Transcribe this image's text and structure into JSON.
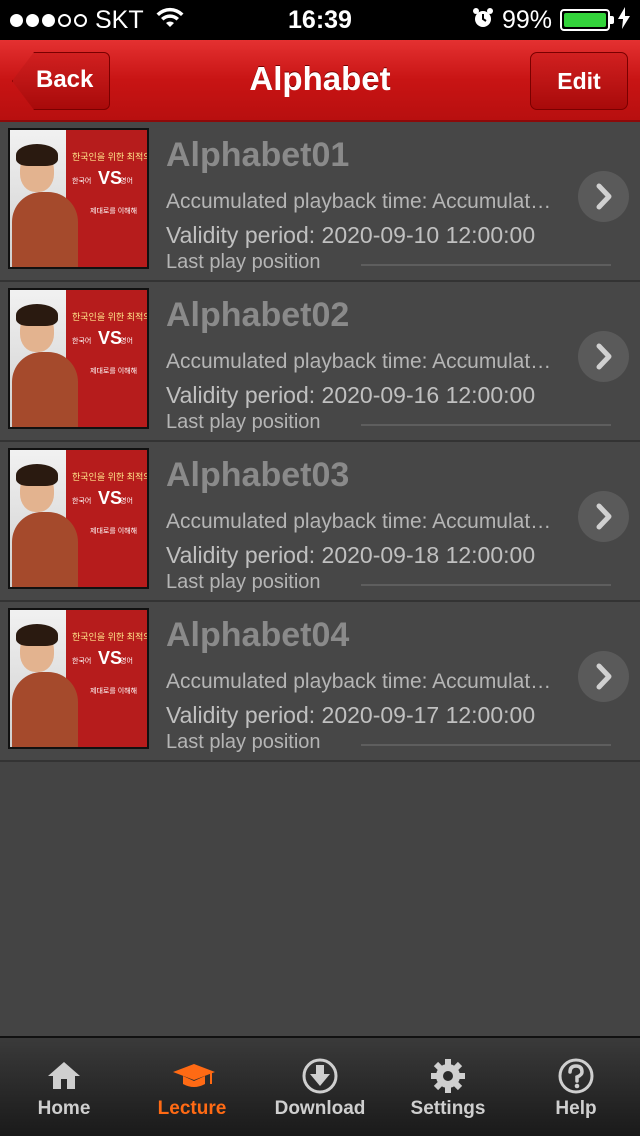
{
  "status_bar": {
    "carrier": "SKT",
    "time": "16:39",
    "battery_percent": "99%",
    "battery_level": 0.99,
    "signal_bars_filled": 3,
    "signal_bars_total": 5
  },
  "nav": {
    "title": "Alphabet",
    "back_label": "Back",
    "edit_label": "Edit"
  },
  "lectures": [
    {
      "title": "Alphabet01",
      "accumulated": "Accumulated playback time: Accumulated playback time",
      "validity": "Validity period: 2020-09-10 12:00:00",
      "last_play": "Last play position"
    },
    {
      "title": "Alphabet02",
      "accumulated": "Accumulated playback time: Accumulated playback time",
      "validity": "Validity period: 2020-09-16 12:00:00",
      "last_play": "Last play position"
    },
    {
      "title": "Alphabet03",
      "accumulated": "Accumulated playback time: Accumulated playback time",
      "validity": "Validity period: 2020-09-18 12:00:00",
      "last_play": "Last play position"
    },
    {
      "title": "Alphabet04",
      "accumulated": "Accumulated playback time: Accumulated playback time",
      "validity": "Validity period: 2020-09-17 12:00:00",
      "last_play": "Last play position"
    }
  ],
  "thumbnail_text": {
    "line1": "한국인을 위한 최적의 영어 학습법",
    "vs": "VS",
    "left_word": "한국어",
    "right_word": "영어",
    "line2": "제대로를 이해해"
  },
  "tabs": [
    {
      "label": "Home",
      "icon": "home-icon",
      "active": false
    },
    {
      "label": "Lecture",
      "icon": "graduation-cap-icon",
      "active": true
    },
    {
      "label": "Download",
      "icon": "download-icon",
      "active": false
    },
    {
      "label": "Settings",
      "icon": "gear-icon",
      "active": false
    },
    {
      "label": "Help",
      "icon": "help-icon",
      "active": false
    }
  ],
  "colors": {
    "accent": "#ff6a14",
    "nav_red": "#c81414",
    "battery_green": "#33d33b"
  }
}
